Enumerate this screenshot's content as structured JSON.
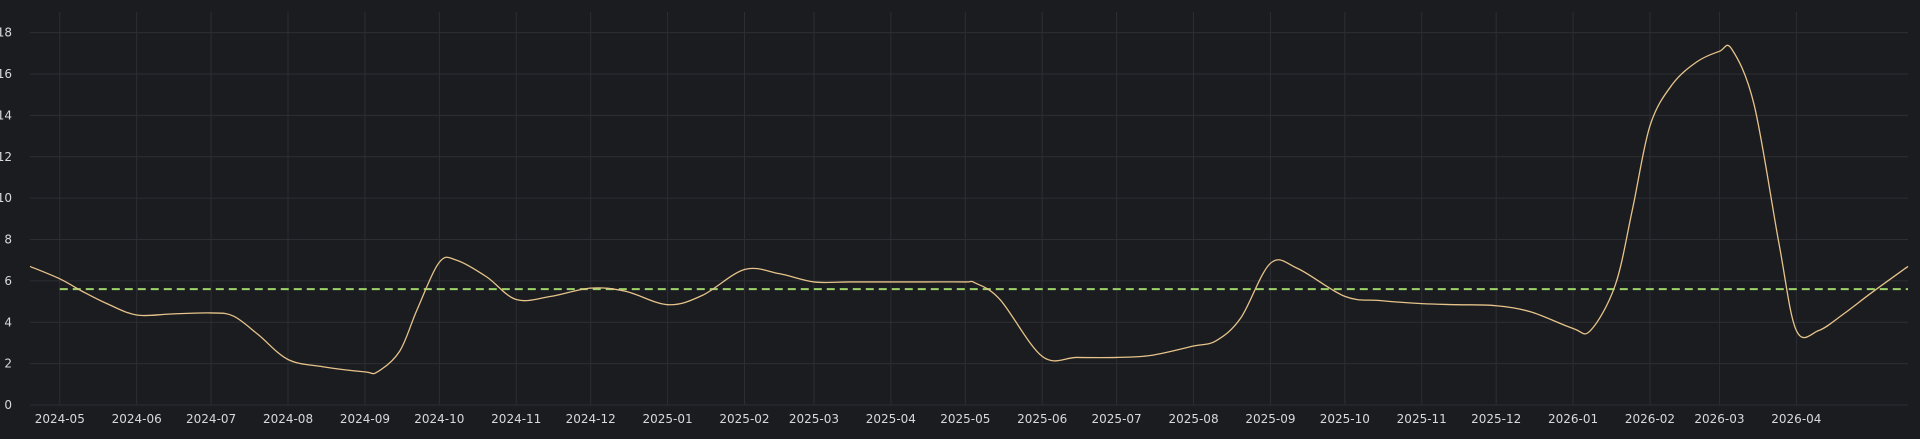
{
  "chart_data": {
    "type": "line",
    "title": "",
    "xlabel": "",
    "ylabel": "",
    "xlim": [
      "2024-04-19",
      "2026-05-16"
    ],
    "ylim": [
      0,
      19
    ],
    "grid": true,
    "colors": {
      "background": "#1b1c20",
      "grid": "#2c2e33",
      "series": "#e6c38a",
      "threshold": "#9ed26a",
      "tick_text": "#d8d9dc"
    },
    "y_ticks": [
      "0",
      "2",
      "4",
      "6",
      "8",
      "10",
      "12",
      "14",
      "16",
      "18"
    ],
    "x_ticks": [
      "2024-05",
      "2024-06",
      "2024-07",
      "2024-08",
      "2024-09",
      "2024-10",
      "2024-11",
      "2024-12",
      "2025-01",
      "2025-02",
      "2025-03",
      "2025-04",
      "2025-05",
      "2025-06",
      "2025-07",
      "2025-08",
      "2025-09",
      "2025-10",
      "2025-11",
      "2025-12",
      "2026-01",
      "2026-02",
      "2026-03",
      "2026-04"
    ],
    "threshold": {
      "value": 5.6,
      "style": "dashed",
      "x_start": "2024-05-01"
    },
    "series": [
      {
        "x": [
          "2024-04-19",
          "2024-05-01",
          "2024-05-10",
          "2024-05-20",
          "2024-06-01",
          "2024-06-15",
          "2024-07-01",
          "2024-07-10",
          "2024-07-20",
          "2024-08-01",
          "2024-08-15",
          "2024-09-01",
          "2024-09-06",
          "2024-09-15",
          "2024-09-22",
          "2024-10-01",
          "2024-10-08",
          "2024-10-20",
          "2024-11-01",
          "2024-11-15",
          "2024-12-01",
          "2024-12-15",
          "2025-01-01",
          "2025-01-15",
          "2025-02-01",
          "2025-02-15",
          "2025-03-01",
          "2025-03-15",
          "2025-04-01",
          "2025-04-15",
          "2025-05-01",
          "2025-05-05",
          "2025-05-15",
          "2025-06-01",
          "2025-06-15",
          "2025-07-01",
          "2025-07-15",
          "2025-08-01",
          "2025-08-10",
          "2025-08-20",
          "2025-09-01",
          "2025-09-12",
          "2025-10-01",
          "2025-10-15",
          "2025-11-01",
          "2025-11-15",
          "2025-12-01",
          "2025-12-15",
          "2026-01-01",
          "2026-01-08",
          "2026-01-18",
          "2026-01-25",
          "2026-02-01",
          "2026-02-10",
          "2026-02-20",
          "2026-03-01",
          "2026-03-06",
          "2026-03-15",
          "2026-03-25",
          "2026-04-01",
          "2026-04-10",
          "2026-04-20",
          "2026-05-01",
          "2026-05-16"
        ],
        "y": [
          6.7,
          6.1,
          5.5,
          4.9,
          4.35,
          4.4,
          4.45,
          4.3,
          3.4,
          2.2,
          1.85,
          1.6,
          1.6,
          2.6,
          4.6,
          6.9,
          7.0,
          6.2,
          5.1,
          5.25,
          5.65,
          5.5,
          4.85,
          5.3,
          6.55,
          6.35,
          5.95,
          5.95,
          5.95,
          5.95,
          5.95,
          5.9,
          5.1,
          2.35,
          2.3,
          2.3,
          2.4,
          2.85,
          3.1,
          4.2,
          6.85,
          6.6,
          5.25,
          5.05,
          4.9,
          4.85,
          4.8,
          4.5,
          3.7,
          3.6,
          5.8,
          9.5,
          13.5,
          15.5,
          16.6,
          17.1,
          17.2,
          14.5,
          7.8,
          3.6,
          3.6,
          4.4,
          5.4,
          6.7
        ]
      }
    ]
  }
}
